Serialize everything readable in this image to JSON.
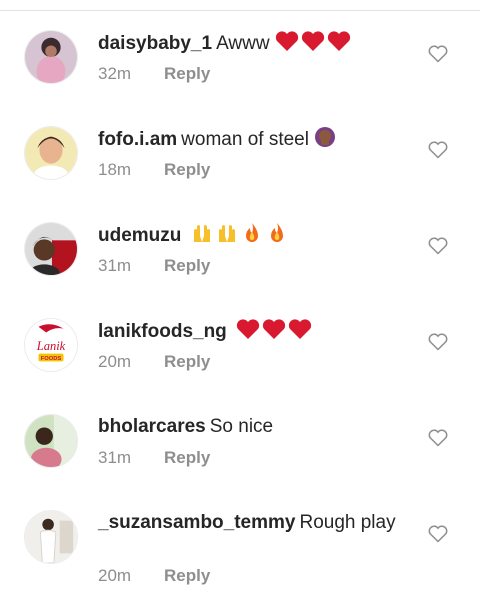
{
  "comments": [
    {
      "username": "daisybaby_1",
      "text": "Awww",
      "emoji": "hearts3",
      "time": "32m",
      "reply": "Reply",
      "avatar": "avatar-photo-pink"
    },
    {
      "username": "fofo.i.am",
      "text": "woman of steel",
      "emoji": "facepalm",
      "time": "18m",
      "reply": "Reply",
      "avatar": "avatar-photo-yellow"
    },
    {
      "username": "udemuzu",
      "text": "",
      "emoji": "raised-hands-fire",
      "time": "31m",
      "reply": "Reply",
      "avatar": "avatar-photo-red"
    },
    {
      "username": "lanikfoods_ng",
      "text": "",
      "emoji": "hearts3",
      "time": "20m",
      "reply": "Reply",
      "avatar": "lanik-foods-logo"
    },
    {
      "username": "bholarcares",
      "text": "So nice",
      "emoji": "",
      "time": "31m",
      "reply": "Reply",
      "avatar": "avatar-photo-green"
    },
    {
      "username": "_suzansambo_temmy",
      "text": "Rough play",
      "emoji": "",
      "time": "20m",
      "reply": "Reply",
      "avatar": "avatar-photo-white"
    }
  ],
  "lanik_logo": {
    "word": "Lanik",
    "sub": "FOODS"
  },
  "colors": {
    "heart_red": "#d8192f",
    "meta_gray": "#8e8e8e",
    "text": "#262626"
  }
}
